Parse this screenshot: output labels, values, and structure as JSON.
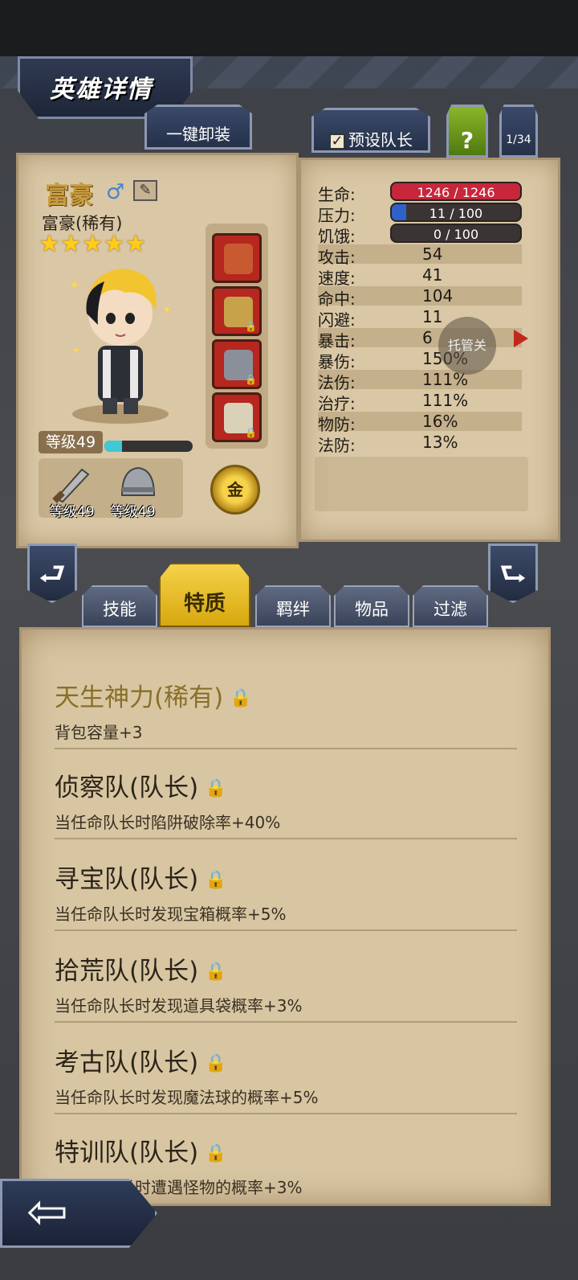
{
  "header": {
    "title": "英雄详情"
  },
  "toolbar": {
    "unequip_label": "一键卸装",
    "leader_checkbox_mark": "✓",
    "leader_label": "预设队长",
    "help_label": "?",
    "counter": "1/34"
  },
  "hero": {
    "name": "富豪",
    "gender_icon": "male-symbol-icon",
    "subtitle": "富豪(稀有)",
    "stars": "★★★★★",
    "level": "等级49",
    "xp_progress": 0.2,
    "weapon_level": "等级49",
    "armor_level": "等级49",
    "currency_label": "金"
  },
  "stats": {
    "hp_label": "生命:",
    "hp_value": "1246 / 1246",
    "hp_fraction": 1.0,
    "stress_label": "压力:",
    "stress_value": "11 / 100",
    "stress_fraction": 0.11,
    "hunger_label": "饥饿:",
    "hunger_value": "0 / 100",
    "hunger_fraction": 0.0,
    "rows": [
      {
        "label": "攻击:",
        "value": "54"
      },
      {
        "label": "速度:",
        "value": "41"
      },
      {
        "label": "命中:",
        "value": "104"
      },
      {
        "label": "闪避:",
        "value": "11"
      },
      {
        "label": "暴击:",
        "value": "6"
      },
      {
        "label": "暴伤:",
        "value": "150%"
      },
      {
        "label": "法伤:",
        "value": "111%"
      },
      {
        "label": "治疗:",
        "value": "111%"
      },
      {
        "label": "物防:",
        "value": "16%"
      },
      {
        "label": "法防:",
        "value": "13%"
      }
    ],
    "auto_label": "托管关"
  },
  "tabs": [
    {
      "label": "技能"
    },
    {
      "label": "特质"
    },
    {
      "label": "羁绊"
    },
    {
      "label": "物品"
    },
    {
      "label": "过滤"
    }
  ],
  "traits": [
    {
      "name": "天生神力(稀有)",
      "desc": "背包容量+3"
    },
    {
      "name": "侦察队(队长)",
      "desc": "当任命队长时陷阱破除率+40%"
    },
    {
      "name": "寻宝队(队长)",
      "desc": "当任命队长时发现宝箱概率+5%"
    },
    {
      "name": "拾荒队(队长)",
      "desc": "当任命队长时发现道具袋概率+3%"
    },
    {
      "name": "考古队(队长)",
      "desc": "当任命队长时发现魔法球的概率+5%"
    },
    {
      "name": "特训队(队长)",
      "desc": "当任命队长时遭遇怪物的概率+3%"
    }
  ],
  "colors": {
    "hp": "#c8263a",
    "stress": "#2e62c8",
    "accent_tab": "#f5d24a"
  }
}
